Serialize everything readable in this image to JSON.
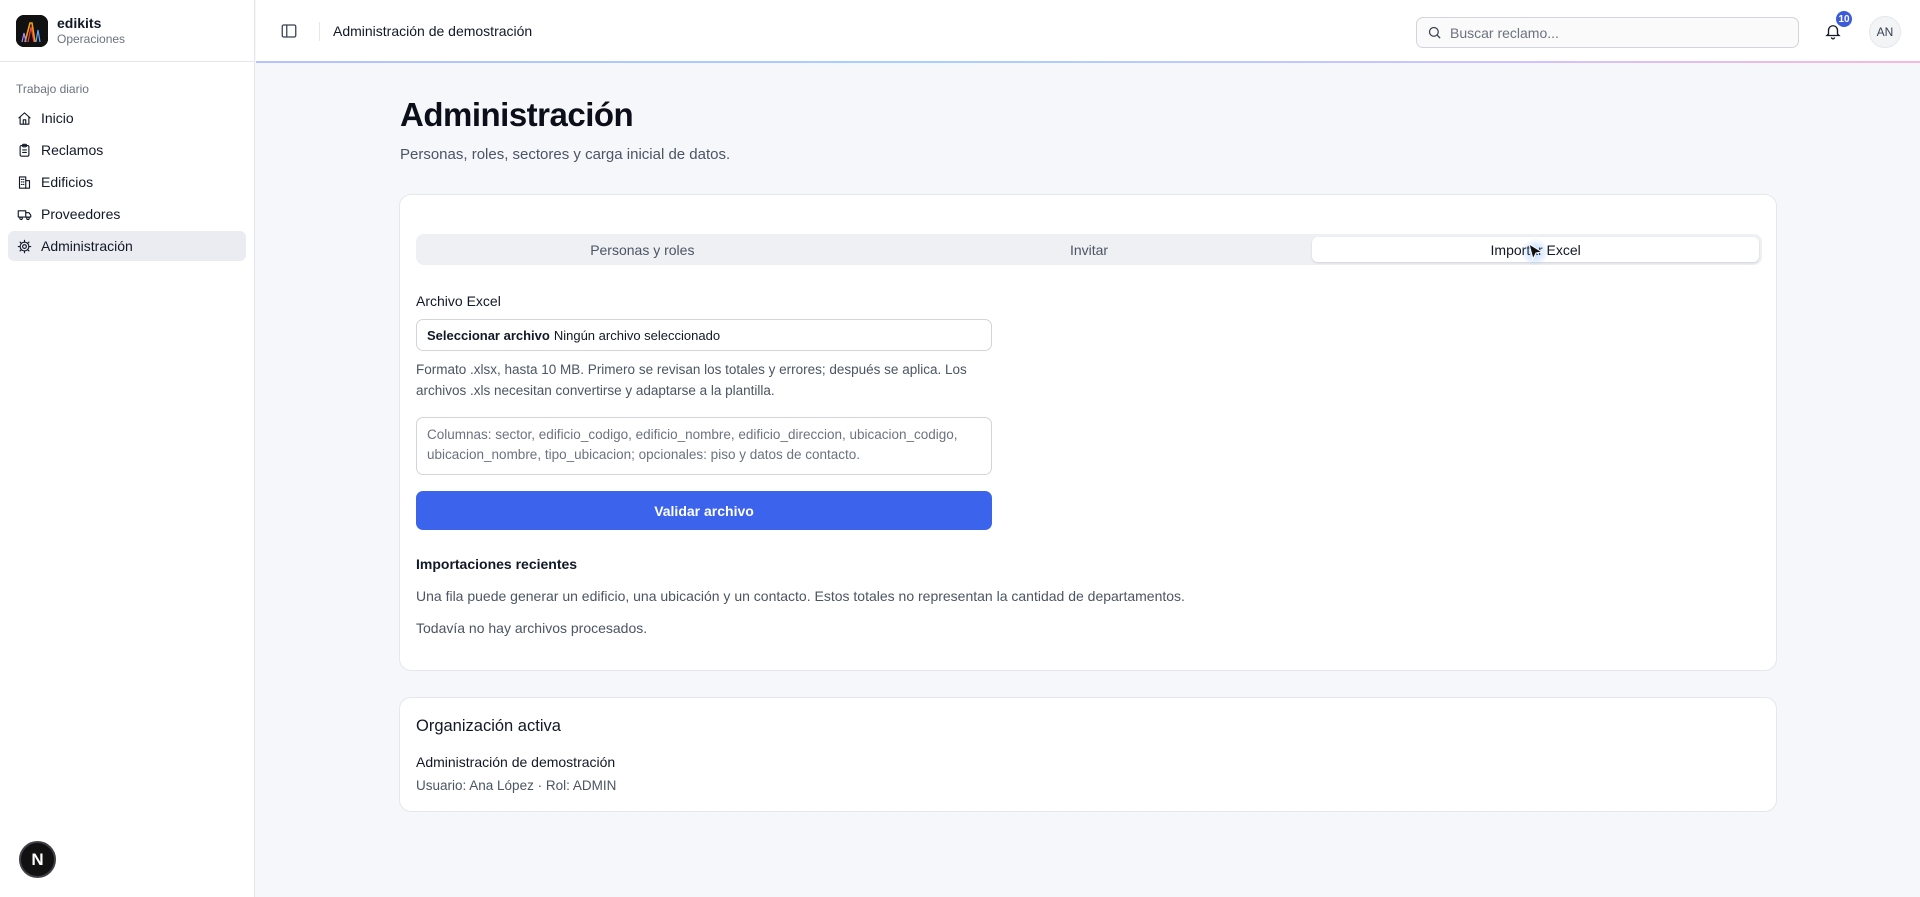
{
  "sidebar": {
    "brand_name": "edikits",
    "brand_sub": "Operaciones",
    "group_label": "Trabajo diario",
    "items": [
      {
        "label": "Inicio",
        "icon": "home-icon"
      },
      {
        "label": "Reclamos",
        "icon": "clipboard-icon"
      },
      {
        "label": "Edificios",
        "icon": "building-icon"
      },
      {
        "label": "Proveedores",
        "icon": "truck-icon"
      },
      {
        "label": "Administración",
        "icon": "gear-icon",
        "active": true
      }
    ],
    "dev_badge": "N"
  },
  "topbar": {
    "breadcrumb": "Administración de demostración",
    "search_placeholder": "Buscar reclamo...",
    "notification_count": "10",
    "avatar_initials": "AN"
  },
  "page": {
    "title": "Administración",
    "subtitle": "Personas, roles, sectores y carga inicial de datos."
  },
  "tabs": [
    {
      "label": "Personas y roles",
      "active": false
    },
    {
      "label": "Invitar",
      "active": false
    },
    {
      "label": "Importar Excel",
      "active": true
    }
  ],
  "import": {
    "file_label": "Archivo Excel",
    "file_button": "Seleccionar archivo",
    "file_status": "Ningún archivo seleccionado",
    "help": "Formato .xlsx, hasta 10 MB. Primero se revisan los totales y errores; después se aplica. Los archivos .xls necesitan convertirse y adaptarse a la plantilla.",
    "columns_placeholder": "Columnas: sector, edificio_codigo, edificio_nombre, edificio_direccion, ubicacion_codigo, ubicacion_nombre, tipo_ubicacion; opcionales: piso y datos de contacto.",
    "validate_button": "Validar archivo",
    "recent_title": "Importaciones recientes",
    "recent_note": "Una fila puede generar un edificio, una ubicación y un contacto. Estos totales no representan la cantidad de departamentos.",
    "recent_empty": "Todavía no hay archivos procesados."
  },
  "organization": {
    "title": "Organización activa",
    "name": "Administración de demostración",
    "user": "Usuario: Ana López",
    "role": "Rol: ADMIN"
  },
  "colors": {
    "accent": "#3c63ec",
    "badge": "#3b5bdb",
    "active_nav": "#eaecf1"
  }
}
